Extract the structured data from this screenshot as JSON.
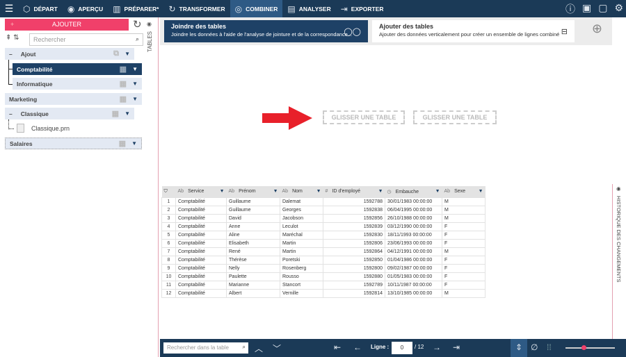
{
  "nav": {
    "tabs": [
      {
        "label": "DÉPART",
        "icon": "cube-icon",
        "glyph": "⬡"
      },
      {
        "label": "APERÇU",
        "icon": "eye-icon",
        "glyph": "◉"
      },
      {
        "label": "PRÉPARER*",
        "icon": "columns-icon",
        "glyph": "▥"
      },
      {
        "label": "TRANSFORMER",
        "icon": "cycle-icon",
        "glyph": "↻"
      },
      {
        "label": "COMBINER",
        "icon": "combine-icon",
        "glyph": "◎",
        "active": true
      },
      {
        "label": "ANALYSER",
        "icon": "clipboard-icon",
        "glyph": "▤"
      },
      {
        "label": "EXPORTER",
        "icon": "export-icon",
        "glyph": "⇥"
      }
    ]
  },
  "left": {
    "add_label": "AJOUTER",
    "search_placeholder": "Rechercher",
    "tables_label": "TABLES",
    "nodes": [
      {
        "label": "Ajout",
        "expander": "–"
      },
      {
        "label": "Comptabilité",
        "selected": true
      },
      {
        "label": "Informatique"
      },
      {
        "label": "Marketing"
      },
      {
        "label": "Classique",
        "expander": "–"
      },
      {
        "label": "Salaires"
      }
    ],
    "file": "Classique.prn"
  },
  "cards": [
    {
      "title": "Joindre des tables",
      "desc": "Joindre les données à l'aide de l'analyse de jointure et de la correspondance...",
      "active": true
    },
    {
      "title": "Ajouter des tables",
      "desc": "Ajouter des données verticalement pour créer un ensemble de lignes combiné"
    }
  ],
  "drop": [
    "GLISSER UNE TABLE",
    "GLISSER UNE TABLE"
  ],
  "accent": "#f0406a",
  "arrow_color": "#e8202a",
  "table": {
    "columns": [
      {
        "type": "Ab",
        "name": "Service"
      },
      {
        "type": "Ab",
        "name": "Prénom"
      },
      {
        "type": "Ab",
        "name": "Nom"
      },
      {
        "type": "#",
        "name": "ID d'employé"
      },
      {
        "type": "◷",
        "name": "Embauche"
      },
      {
        "type": "Ab",
        "name": "Sexe"
      }
    ],
    "rows": [
      [
        "1",
        "Comptabilité",
        "Guillaume",
        "Dalemat",
        "1592788",
        "30/01/1983 00:00:00",
        "M"
      ],
      [
        "2",
        "Comptabilité",
        "Guillaume",
        "Georges",
        "1592838",
        "06/04/1995 00:00:00",
        "M"
      ],
      [
        "3",
        "Comptabilité",
        "David",
        "Jacobson",
        "1592856",
        "26/10/1988 00:00:00",
        "M"
      ],
      [
        "4",
        "Comptabilité",
        "Anne",
        "Leculot",
        "1592839",
        "03/12/1990 00:00:00",
        "F"
      ],
      [
        "5",
        "Comptabilité",
        "Aline",
        "Maréchal",
        "1592830",
        "18/11/1993 00:00:00",
        "F"
      ],
      [
        "6",
        "Comptabilité",
        "Elisabeth",
        "Martin",
        "1592806",
        "23/06/1993 00:00:00",
        "F"
      ],
      [
        "7",
        "Comptabilité",
        "René",
        "Martin",
        "1592864",
        "04/12/1991 00:00:00",
        "M"
      ],
      [
        "8",
        "Comptabilité",
        "Thérèse",
        "Poretski",
        "1592850",
        "01/04/1986 00:00:00",
        "F"
      ],
      [
        "9",
        "Comptabilité",
        "Nelly",
        "Rosenberg",
        "1592800",
        "09/02/1987 00:00:00",
        "F"
      ],
      [
        "10",
        "Comptabilité",
        "Paulette",
        "Rousso",
        "1592880",
        "01/05/1983 00:00:00",
        "F"
      ],
      [
        "11",
        "Comptabilité",
        "Marianne",
        "Stancort",
        "1592789",
        "10/11/1987 00:00:00",
        "F"
      ],
      [
        "12",
        "Comptabilité",
        "Albert",
        "Vernille",
        "1592814",
        "13/10/1985 00:00:00",
        "M"
      ]
    ]
  },
  "history_label": "HISTORIQUE DES CHANGEMENTS",
  "bottom": {
    "search_placeholder": "Rechercher dans la table",
    "line_label": "Ligne :",
    "line_value": "0",
    "total": "/ 12",
    "zoom_level": 0.37
  }
}
